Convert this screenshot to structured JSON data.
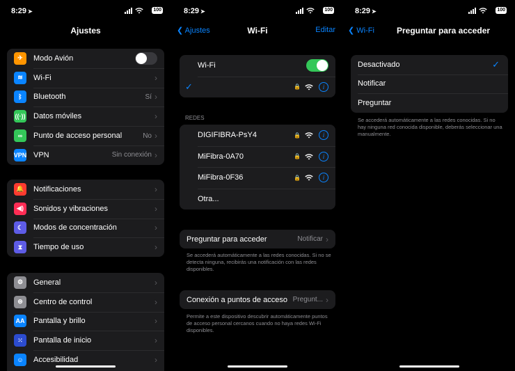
{
  "status": {
    "time": "8:29",
    "battery": "100"
  },
  "settings": {
    "title": "Ajustes",
    "group1": [
      {
        "label": "Modo Avión",
        "icon": "airplane-icon",
        "color": "#ff9500",
        "glyph": "✈",
        "toggle": false
      },
      {
        "label": "Wi-Fi",
        "icon": "wifi-icon",
        "color": "#0a84ff",
        "glyph": "≋",
        "value": ""
      },
      {
        "label": "Bluetooth",
        "icon": "bluetooth-icon",
        "color": "#0a84ff",
        "glyph": "ᛒ",
        "value": "Sí"
      },
      {
        "label": "Datos móviles",
        "icon": "antenna-icon",
        "color": "#34c759",
        "glyph": "((·))",
        "value": ""
      },
      {
        "label": "Punto de acceso personal",
        "icon": "hotspot-icon",
        "color": "#34c759",
        "glyph": "∞",
        "value": "No"
      },
      {
        "label": "VPN",
        "icon": "vpn-icon",
        "color": "#0a84ff",
        "glyph": "VPN",
        "value": "Sin conexión"
      }
    ],
    "group2": [
      {
        "label": "Notificaciones",
        "icon": "bell-icon",
        "color": "#ff3b30",
        "glyph": "🔔"
      },
      {
        "label": "Sonidos y vibraciones",
        "icon": "speaker-icon",
        "color": "#ff2d55",
        "glyph": "◀)"
      },
      {
        "label": "Modos de concentración",
        "icon": "moon-icon",
        "color": "#5e5ce6",
        "glyph": "☾"
      },
      {
        "label": "Tiempo de uso",
        "icon": "hourglass-icon",
        "color": "#5e5ce6",
        "glyph": "⧗"
      }
    ],
    "group3": [
      {
        "label": "General",
        "icon": "gear-icon",
        "color": "#8e8e93",
        "glyph": "⚙"
      },
      {
        "label": "Centro de control",
        "icon": "toggles-icon",
        "color": "#8e8e93",
        "glyph": "⊜"
      },
      {
        "label": "Pantalla y brillo",
        "icon": "text-size-icon",
        "color": "#0a84ff",
        "glyph": "AA"
      },
      {
        "label": "Pantalla de inicio",
        "icon": "grid-icon",
        "color": "#2c4ccf",
        "glyph": "⁙"
      },
      {
        "label": "Accesibilidad",
        "icon": "accessibility-icon",
        "color": "#0a84ff",
        "glyph": "☺"
      }
    ]
  },
  "wifi": {
    "back": "Ajustes",
    "title": "Wi-Fi",
    "edit": "Editar",
    "toggle_label": "Wi-Fi",
    "toggle_on": true,
    "networks_header": "REDES",
    "networks": [
      "DIGIFIBRA-PsY4",
      "MiFibra-0A70",
      "MiFibra-0F36"
    ],
    "other": "Otra...",
    "ask_label": "Preguntar para acceder",
    "ask_value": "Notificar",
    "ask_footer": "Se accederá automáticamente a las redes conocidas. Si no se detecta ninguna, recibirás una notificación con las redes disponibles.",
    "hotspot_label": "Conexión a puntos de acceso",
    "hotspot_value": "Pregunt...",
    "hotspot_footer": "Permite a este dispositivo descubrir automáticamente puntos de acceso personal cercanos cuando no haya redes Wi-Fi disponibles."
  },
  "ask": {
    "back": "Wi-Fi",
    "title": "Preguntar para acceder",
    "options": [
      "Desactivado",
      "Notificar",
      "Preguntar"
    ],
    "selected": "Desactivado",
    "footer": "Se accederá automáticamente a las redes conocidas. Si no hay ninguna red conocida disponible, deberás seleccionar una manualmente."
  }
}
